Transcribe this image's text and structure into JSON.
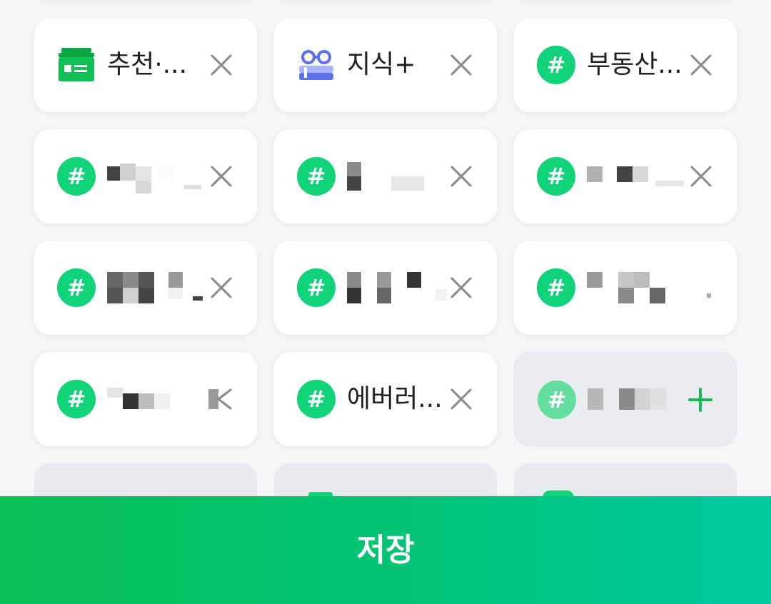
{
  "tiles": {
    "t1": {
      "label": "추천·...",
      "action": "remove"
    },
    "t2": {
      "label": "지식+",
      "action": "remove"
    },
    "t3": {
      "label": "부동산...",
      "action": "remove"
    },
    "t13": {
      "label": "에버러...",
      "action": "remove"
    }
  },
  "icons": {
    "hash_glyph": "#",
    "remove_icon": "close-icon",
    "add_icon": "plus-icon",
    "news_icon": "newspaper-icon",
    "kin_icon": "knowledge-icon"
  },
  "colors": {
    "accent_green": "#10d278",
    "add_plus_green": "#12b657",
    "kin_blue": "#5b6ff0",
    "close_gray": "#888888",
    "save_gradient_start": "#08c058",
    "save_gradient_end": "#00c8a0"
  },
  "save_button": {
    "label": "저장"
  }
}
